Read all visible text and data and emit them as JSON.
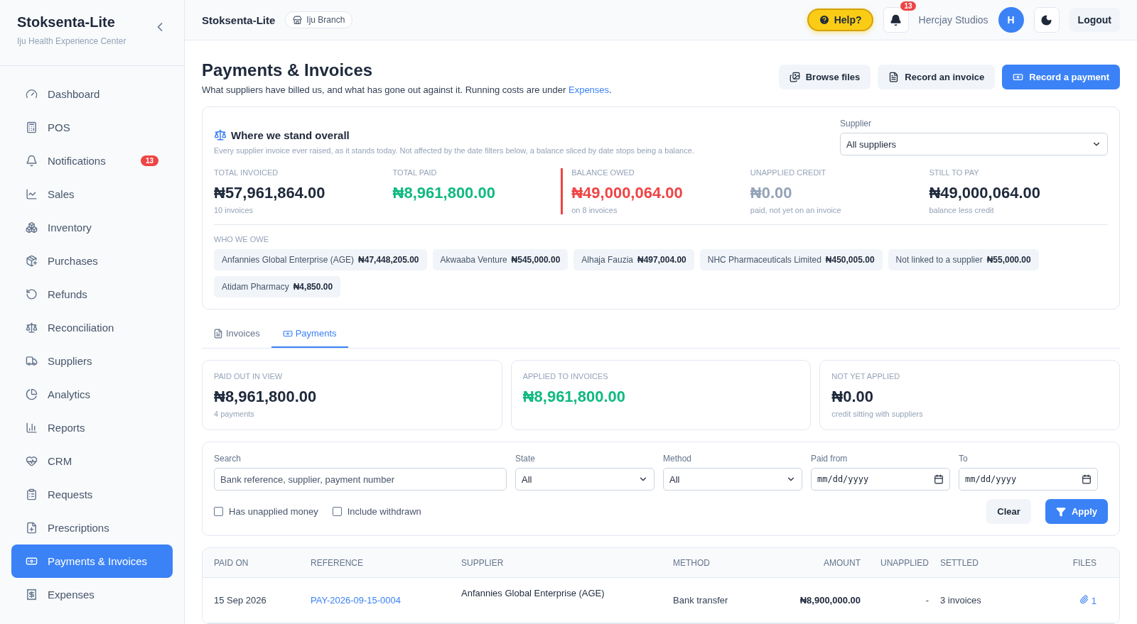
{
  "sidebar": {
    "brand": "Stoksenta-Lite",
    "subtitle": "Iju Health Experience Center",
    "items": [
      {
        "label": "Dashboard",
        "selected": false
      },
      {
        "label": "POS",
        "selected": false
      },
      {
        "label": "Notifications",
        "selected": false,
        "badge": "13"
      },
      {
        "label": "Sales",
        "selected": false
      },
      {
        "label": "Inventory",
        "selected": false
      },
      {
        "label": "Purchases",
        "selected": false
      },
      {
        "label": "Refunds",
        "selected": false
      },
      {
        "label": "Reconciliation",
        "selected": false
      },
      {
        "label": "Suppliers",
        "selected": false
      },
      {
        "label": "Analytics",
        "selected": false
      },
      {
        "label": "Reports",
        "selected": false
      },
      {
        "label": "CRM",
        "selected": false
      },
      {
        "label": "Requests",
        "selected": false
      },
      {
        "label": "Prescriptions",
        "selected": false
      },
      {
        "label": "Payments & Invoices",
        "selected": true
      },
      {
        "label": "Expenses",
        "selected": false
      }
    ]
  },
  "topbar": {
    "app_name": "Stoksenta-Lite",
    "branch": "Iju Branch",
    "help": "Help?",
    "notification_count": "13",
    "user": "Hercjay Studios",
    "avatar": "H",
    "logout": "Logout"
  },
  "page": {
    "title": "Payments & Invoices",
    "description": "What suppliers have billed us, and what has gone out against it. Running costs are under ",
    "description_link": "Expenses",
    "description_end": ".",
    "actions": [
      {
        "label": "Browse files",
        "kind": "secondary"
      },
      {
        "label": "Record an invoice",
        "kind": "secondary"
      },
      {
        "label": "Record a payment",
        "kind": "primary"
      }
    ]
  },
  "overview": {
    "title": "Where we stand overall",
    "note": "Every supplier invoice ever raised, as it stands today. Not affected by the date filters below, a balance sliced by date stops being a balance.",
    "supplier_label": "Supplier",
    "supplier_value": "All suppliers",
    "stats": [
      {
        "label": "TOTAL INVOICED",
        "value": "₦57,961,864.00",
        "note": "10 invoices",
        "color": "#1e293b",
        "flagged": false
      },
      {
        "label": "TOTAL PAID",
        "value": "₦8,961,800.00",
        "color": "#10b981",
        "flagged": false
      },
      {
        "label": "BALANCE OWED",
        "value": "₦49,000,064.00",
        "note": "on 8 invoices",
        "color": "#ef4444",
        "flagged": true
      },
      {
        "label": "UNAPPLIED CREDIT",
        "value": "₦0.00",
        "note": "paid, not yet on an invoice",
        "color": "#94a3b8",
        "flagged": false
      },
      {
        "label": "STILL TO PAY",
        "value": "₦49,000,064.00",
        "note": "balance less credit",
        "color": "#1e293b",
        "flagged": false
      }
    ],
    "owed_label": "WHO WE OWE",
    "owed": [
      {
        "name": "Anfannies Global Enterprise (AGE)",
        "amount": "₦47,448,205.00"
      },
      {
        "name": "Akwaaba Venture",
        "amount": "₦545,000.00"
      },
      {
        "name": "Alhaja Fauzia",
        "amount": "₦497,004.00"
      },
      {
        "name": "NHC Pharmaceuticals Limited",
        "amount": "₦450,005.00"
      },
      {
        "name": "Not linked to a supplier",
        "amount": "₦55,000.00"
      },
      {
        "name": "Atidam Pharmacy",
        "amount": "₦4,850.00"
      }
    ]
  },
  "tabs": [
    {
      "label": "Invoices",
      "selected": false
    },
    {
      "label": "Payments",
      "selected": true
    }
  ],
  "summary": [
    {
      "label": "PAID OUT IN VIEW",
      "value": "₦8,961,800.00",
      "note": "4 payments",
      "color": "#1e293b"
    },
    {
      "label": "APPLIED TO INVOICES",
      "value": "₦8,961,800.00",
      "color": "#10b981"
    },
    {
      "label": "NOT YET APPLIED",
      "value": "₦0.00",
      "note": "credit sitting with suppliers",
      "color": "#1e293b"
    }
  ],
  "filters": {
    "search": {
      "label": "Search",
      "placeholder": "Bank reference, supplier, payment number"
    },
    "selects": [
      {
        "label": "State",
        "value": "All"
      },
      {
        "label": "Method",
        "value": "All"
      }
    ],
    "dates": [
      {
        "label": "Paid from",
        "placeholder": "mm/dd/yyyy"
      },
      {
        "label": "To",
        "placeholder": "mm/dd/yyyy"
      }
    ],
    "checkboxes": [
      {
        "label": "Has unapplied money",
        "checked": false
      },
      {
        "label": "Include withdrawn",
        "checked": false
      }
    ],
    "clear": "Clear",
    "apply": "Apply"
  },
  "table": {
    "columns": [
      "PAID ON",
      "REFERENCE",
      "SUPPLIER",
      "METHOD",
      "AMOUNT",
      "UNAPPLIED",
      "SETTLED",
      "FILES"
    ],
    "rows": [
      {
        "paid_on": "15 Sep 2026",
        "reference": "PAY-2026-09-15-0004",
        "supplier": "Anfannies Global Enterprise (AGE)",
        "method": "Bank transfer",
        "amount": "₦8,900,000.00",
        "unapplied": "-",
        "settled": "3 invoices",
        "files": "1"
      }
    ]
  }
}
